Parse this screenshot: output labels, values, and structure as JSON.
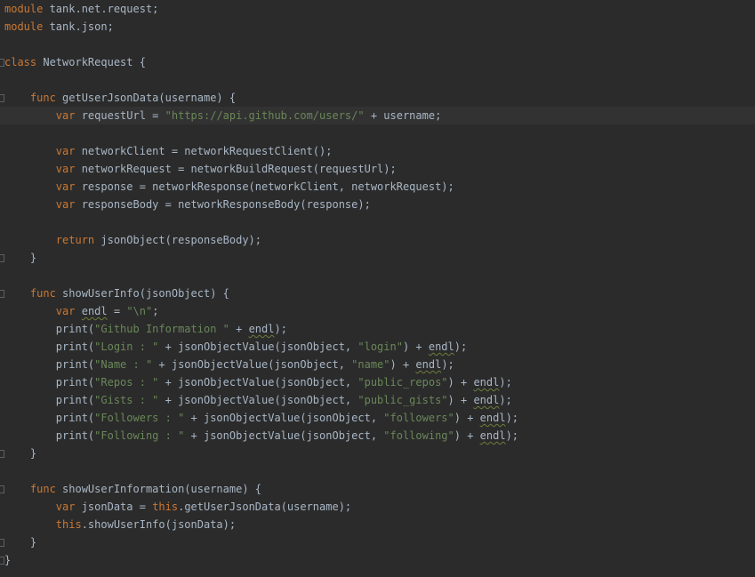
{
  "editor": {
    "lines": [
      [
        [
          "kw",
          "module"
        ],
        [
          "t",
          " tank.net.request;"
        ]
      ],
      [
        [
          "kw",
          "module"
        ],
        [
          "t",
          " tank.json;"
        ]
      ],
      [],
      [
        [
          "kw",
          "class"
        ],
        [
          "t",
          " NetworkRequest {"
        ]
      ],
      [],
      [
        [
          "t",
          "    "
        ],
        [
          "kw",
          "func"
        ],
        [
          "t",
          " getUserJsonData(username) {"
        ]
      ],
      [
        [
          "t",
          "        "
        ],
        [
          "kw",
          "var"
        ],
        [
          "t",
          " requestUrl = "
        ],
        [
          "str",
          "\"https://api.github.com/users/\""
        ],
        [
          "t",
          " + username;"
        ]
      ],
      [],
      [
        [
          "t",
          "        "
        ],
        [
          "kw",
          "var"
        ],
        [
          "t",
          " networkClient = networkRequestClient();"
        ]
      ],
      [
        [
          "t",
          "        "
        ],
        [
          "kw",
          "var"
        ],
        [
          "t",
          " networkRequest = networkBuildRequest(requestUrl);"
        ]
      ],
      [
        [
          "t",
          "        "
        ],
        [
          "kw",
          "var"
        ],
        [
          "t",
          " response = networkResponse(networkClient, networkRequest);"
        ]
      ],
      [
        [
          "t",
          "        "
        ],
        [
          "kw",
          "var"
        ],
        [
          "t",
          " responseBody = networkResponseBody(response);"
        ]
      ],
      [],
      [
        [
          "t",
          "        "
        ],
        [
          "kw",
          "return"
        ],
        [
          "t",
          " jsonObject(responseBody);"
        ]
      ],
      [
        [
          "t",
          "    }"
        ]
      ],
      [],
      [
        [
          "t",
          "    "
        ],
        [
          "kw",
          "func"
        ],
        [
          "t",
          " showUserInfo(jsonObject) {"
        ]
      ],
      [
        [
          "t",
          "        "
        ],
        [
          "kw",
          "var"
        ],
        [
          "t",
          " "
        ],
        [
          "typo",
          "endl"
        ],
        [
          "t",
          " = "
        ],
        [
          "str",
          "\"\\n\""
        ],
        [
          "t",
          ";"
        ]
      ],
      [
        [
          "t",
          "        print("
        ],
        [
          "str",
          "\"Github Information \""
        ],
        [
          "t",
          " + "
        ],
        [
          "typo",
          "endl"
        ],
        [
          "t",
          ");"
        ]
      ],
      [
        [
          "t",
          "        print("
        ],
        [
          "str",
          "\"Login : \""
        ],
        [
          "t",
          " + jsonObjectValue(jsonObject, "
        ],
        [
          "str",
          "\"login\""
        ],
        [
          "t",
          ") + "
        ],
        [
          "typo",
          "endl"
        ],
        [
          "t",
          ");"
        ]
      ],
      [
        [
          "t",
          "        print("
        ],
        [
          "str",
          "\"Name : \""
        ],
        [
          "t",
          " + jsonObjectValue(jsonObject, "
        ],
        [
          "str",
          "\"name\""
        ],
        [
          "t",
          ") + "
        ],
        [
          "typo",
          "endl"
        ],
        [
          "t",
          ");"
        ]
      ],
      [
        [
          "t",
          "        print("
        ],
        [
          "str",
          "\"Repos : \""
        ],
        [
          "t",
          " + jsonObjectValue(jsonObject, "
        ],
        [
          "str",
          "\"public_repos\""
        ],
        [
          "t",
          ") + "
        ],
        [
          "typo",
          "endl"
        ],
        [
          "t",
          ");"
        ]
      ],
      [
        [
          "t",
          "        print("
        ],
        [
          "str",
          "\"Gists : \""
        ],
        [
          "t",
          " + jsonObjectValue(jsonObject, "
        ],
        [
          "str",
          "\"public_gists\""
        ],
        [
          "t",
          ") + "
        ],
        [
          "typo",
          "endl"
        ],
        [
          "t",
          ");"
        ]
      ],
      [
        [
          "t",
          "        print("
        ],
        [
          "str",
          "\"Followers : \""
        ],
        [
          "t",
          " + jsonObjectValue(jsonObject, "
        ],
        [
          "str",
          "\"followers\""
        ],
        [
          "t",
          ") + "
        ],
        [
          "typo",
          "endl"
        ],
        [
          "t",
          ");"
        ]
      ],
      [
        [
          "t",
          "        print("
        ],
        [
          "str",
          "\"Following : \""
        ],
        [
          "t",
          " + jsonObjectValue(jsonObject, "
        ],
        [
          "str",
          "\"following\""
        ],
        [
          "t",
          ") + "
        ],
        [
          "typo",
          "endl"
        ],
        [
          "t",
          ");"
        ]
      ],
      [
        [
          "t",
          "    }"
        ]
      ],
      [],
      [
        [
          "t",
          "    "
        ],
        [
          "kw",
          "func"
        ],
        [
          "t",
          " showUserInformation(username) {"
        ]
      ],
      [
        [
          "t",
          "        "
        ],
        [
          "kw",
          "var"
        ],
        [
          "t",
          " jsonData = "
        ],
        [
          "kw",
          "this"
        ],
        [
          "t",
          ".getUserJsonData(username);"
        ]
      ],
      [
        [
          "t",
          "        "
        ],
        [
          "kw",
          "this"
        ],
        [
          "t",
          ".showUserInfo(jsonData);"
        ]
      ],
      [
        [
          "t",
          "    }"
        ]
      ],
      [
        [
          "t",
          "}"
        ]
      ]
    ],
    "current_line": 6,
    "fold_open_lines": [
      3,
      5,
      16,
      27
    ],
    "fold_close_lines": [
      14,
      25,
      30,
      31
    ]
  },
  "colors": {
    "background": "#2b2b2b",
    "current_line": "#323232",
    "text": "#a9b7c6",
    "keyword": "#cc7832",
    "string": "#6a8759",
    "typo_underline": "#6e7d3a",
    "fold_marker": "#5c5f61"
  }
}
